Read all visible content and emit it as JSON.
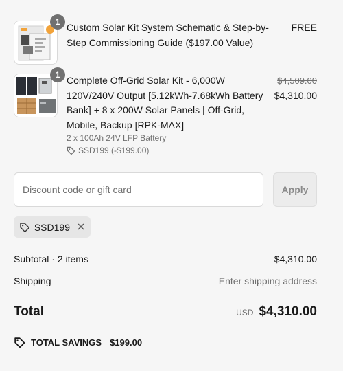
{
  "line_items": [
    {
      "quantity": "1",
      "title": "Custom Solar Kit System Schematic & Step-by-Step Commissioning Guide ($197.00 Value)",
      "price": "FREE",
      "thumbnail_icon": "schematic-guide-image"
    },
    {
      "quantity": "1",
      "title": "Complete Off-Grid Solar Kit - 6,000W 120V/240V Output [5.12kWh-7.68kWh Battery Bank] + 8 x 200W Solar Panels | Off-Grid, Mobile, Backup [RPK-MAX]",
      "variant": "2 x 100Ah 24V LFP Battery",
      "discount": "SSD199 (-$199.00)",
      "original_price": "$4,509.00",
      "price": "$4,310.00",
      "thumbnail_icon": "solar-kit-image"
    }
  ],
  "discount": {
    "placeholder": "Discount code or gift card",
    "apply_label": "Apply",
    "applied_code": "SSD199"
  },
  "summary": {
    "subtotal_label": "Subtotal · 2 items",
    "subtotal_value": "$4,310.00",
    "shipping_label": "Shipping",
    "shipping_value": "Enter shipping address",
    "total_label": "Total",
    "currency": "USD",
    "total_value": "$4,310.00",
    "savings_label": "TOTAL SAVINGS",
    "savings_value": "$199.00"
  },
  "colors": {
    "background": "#f6f6f6",
    "text": "#1a1a1a",
    "muted": "#707070",
    "badge": "#707070"
  }
}
